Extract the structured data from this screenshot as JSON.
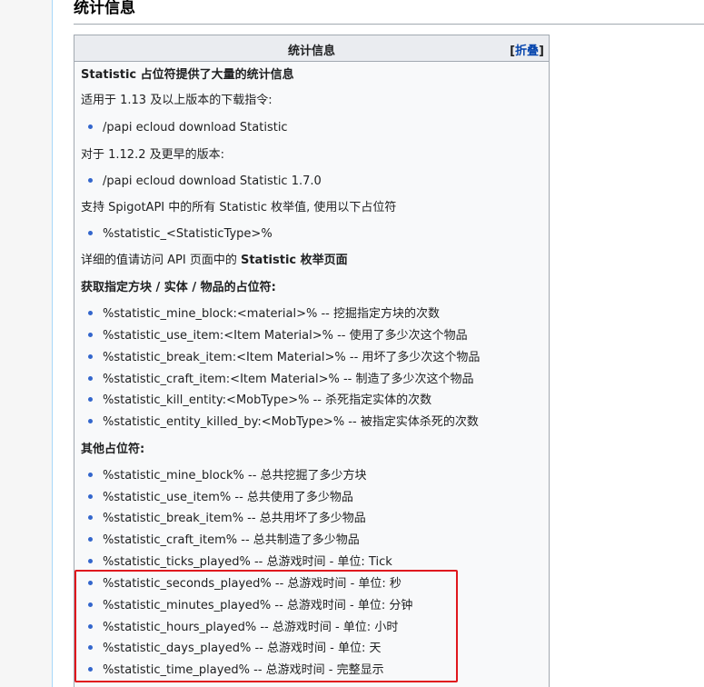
{
  "section": {
    "heading": "统计信息"
  },
  "infobox": {
    "title": "统计信息",
    "toggle_open": "[",
    "toggle_label": "折叠",
    "toggle_close": "]",
    "intro": "Statistic 占位符提供了大量的统计信息",
    "v113_note": "适用于 1.13 及以上版本的下载指令:",
    "v113_command": "/papi ecloud download Statistic",
    "v112_note": "对于 1.12.2 及更早的版本:",
    "v112_command": "/papi ecloud download Statistic 1.7.0",
    "enum_note": "支持 SpigotAPI 中的所有 Statistic 枚举值, 使用以下占位符",
    "enum_placeholder": "%statistic_<StatisticType>%",
    "detail_prefix": "详细的值请访问 API 页面中的 ",
    "detail_bold": "Statistic 枚举页面",
    "block_heading": "获取指定方块 / 实体 / 物品的占位符:",
    "block_items": [
      "%statistic_mine_block:<material>% -- 挖掘指定方块的次数",
      "%statistic_use_item:<Item Material>% -- 使用了多少次这个物品",
      "%statistic_break_item:<Item Material>% -- 用坏了多少次这个物品",
      "%statistic_craft_item:<Item Material>% -- 制造了多少次这个物品",
      "%statistic_kill_entity:<MobType>% -- 杀死指定实体的次数",
      "%statistic_entity_killed_by:<MobType>% -- 被指定实体杀死的次数"
    ],
    "other_heading": "其他占位符:",
    "other_items": [
      "%statistic_mine_block% -- 总共挖掘了多少方块",
      "%statistic_use_item% -- 总共使用了多少物品",
      "%statistic_break_item% -- 总共用坏了多少物品",
      "%statistic_craft_item% -- 总共制造了多少物品",
      "%statistic_ticks_played% -- 总游戏时间 - 单位: Tick",
      "%statistic_seconds_played% -- 总游戏时间 - 单位: 秒",
      "%statistic_minutes_played% -- 总游戏时间 - 单位: 分钟",
      "%statistic_hours_played% -- 总游戏时间 - 单位: 小时",
      "%statistic_days_played% -- 总游戏时间 - 单位: 天",
      "%statistic_time_played% -- 总游戏时间 - 完整显示"
    ]
  },
  "colors": {
    "highlight_border": "#e0171d",
    "link": "#0645ad",
    "bullet": "#3366cc",
    "box_background": "#f8f9fa",
    "header_background": "#eaecf0"
  }
}
